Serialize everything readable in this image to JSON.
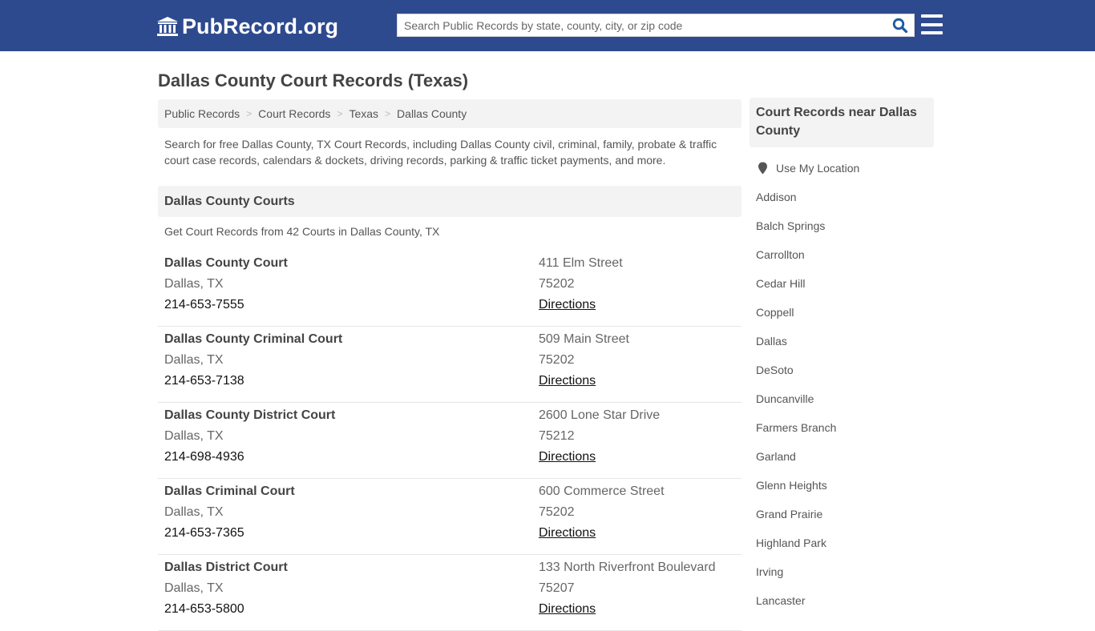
{
  "header": {
    "logo_text": "PubRecord.org",
    "logo_icon": "courthouse-icon",
    "search_placeholder": "Search Public Records by state, county, city, or zip code",
    "search_value": "",
    "search_icon": "search-icon",
    "menu_icon": "hamburger-menu-icon",
    "brand_color": "#2e4a8f",
    "accent_color": "#1a5aa0"
  },
  "page": {
    "title": "Dallas County Court Records (Texas)",
    "breadcrumb": [
      "Public Records",
      "Court Records",
      "Texas",
      "Dallas County"
    ],
    "intro": "Search for free Dallas County, TX Court Records, including Dallas County civil, criminal, family, probate & traffic court case records, calendars & dockets, driving records, parking & traffic ticket payments, and more."
  },
  "courts_section": {
    "heading": "Dallas County Courts",
    "subheading": "Get Court Records from 42 Courts in Dallas County, TX",
    "directions_label": "Directions",
    "courts": [
      {
        "name": "Dallas County Court",
        "city": "Dallas, TX",
        "phone": "214-653-7555",
        "address": "411 Elm Street",
        "zip": "75202"
      },
      {
        "name": "Dallas County Criminal Court",
        "city": "Dallas, TX",
        "phone": "214-653-7138",
        "address": "509 Main Street",
        "zip": "75202"
      },
      {
        "name": "Dallas County District Court",
        "city": "Dallas, TX",
        "phone": "214-698-4936",
        "address": "2600 Lone Star Drive",
        "zip": "75212"
      },
      {
        "name": "Dallas Criminal Court",
        "city": "Dallas, TX",
        "phone": "214-653-7365",
        "address": "600 Commerce Street",
        "zip": "75202"
      },
      {
        "name": "Dallas District Court",
        "city": "Dallas, TX",
        "phone": "214-653-5800",
        "address": "133 North Riverfront Boulevard",
        "zip": "75207"
      }
    ]
  },
  "sidebar": {
    "heading": "Court Records near Dallas County",
    "location_label": "Use My Location",
    "location_icon": "map-pin-icon",
    "cities": [
      "Addison",
      "Balch Springs",
      "Carrollton",
      "Cedar Hill",
      "Coppell",
      "Dallas",
      "DeSoto",
      "Duncanville",
      "Farmers Branch",
      "Garland",
      "Glenn Heights",
      "Grand Prairie",
      "Highland Park",
      "Irving",
      "Lancaster"
    ]
  }
}
